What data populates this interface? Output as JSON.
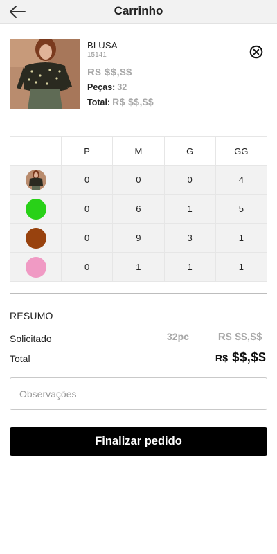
{
  "header": {
    "title": "Carrinho",
    "back_icon": "arrow-left-icon"
  },
  "product": {
    "name": "BLUSA",
    "code": "15141",
    "price": "R$ $$,$$",
    "pieces_label": "Peças:",
    "pieces_value": "32",
    "total_label": "Total:",
    "total_value": "R$ $$,$$",
    "remove_icon": "close-circle-icon"
  },
  "grid": {
    "sizes": [
      "P",
      "M",
      "G",
      "GG"
    ],
    "rows": [
      {
        "swatch": "photo",
        "color": "#5a4a3a",
        "values": [
          "0",
          "0",
          "0",
          "4"
        ]
      },
      {
        "swatch": "color",
        "color": "#29d118",
        "values": [
          "0",
          "6",
          "1",
          "5"
        ]
      },
      {
        "swatch": "color",
        "color": "#98420e",
        "values": [
          "0",
          "9",
          "3",
          "1"
        ]
      },
      {
        "swatch": "color",
        "color": "#f09ac4",
        "values": [
          "0",
          "1",
          "1",
          "1"
        ]
      }
    ]
  },
  "summary": {
    "title": "RESUMO",
    "requested_label": "Solicitado",
    "requested_qty": "32pc",
    "requested_value": "R$ $$,$$",
    "total_label": "Total",
    "total_currency": "R$",
    "total_value": "$$,$$"
  },
  "notes": {
    "placeholder": "Observações",
    "value": ""
  },
  "actions": {
    "finish_label": "Finalizar pedido"
  }
}
